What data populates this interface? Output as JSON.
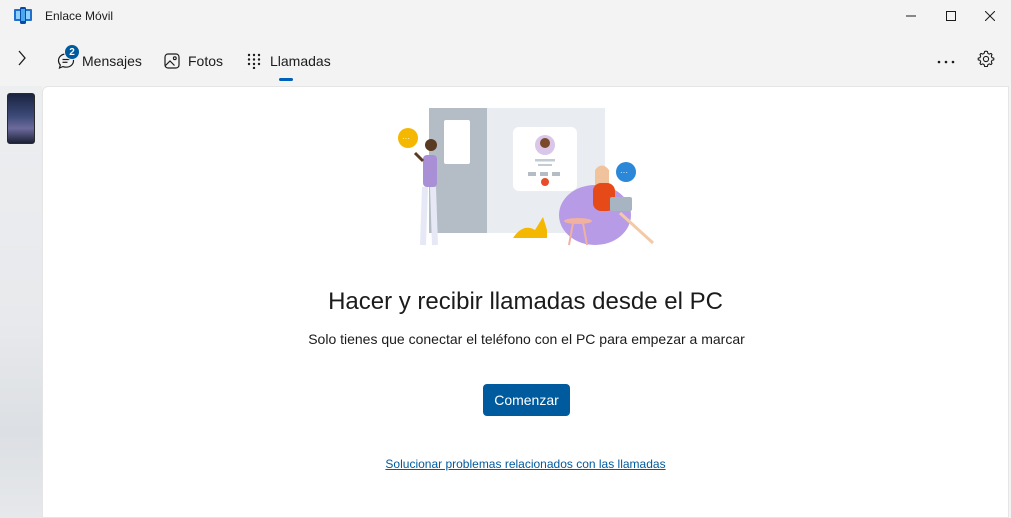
{
  "window": {
    "title": "Enlace Móvil",
    "icons": {
      "app": "phone-link-app-icon",
      "minimize": "minimize-icon",
      "maximize": "maximize-icon",
      "close": "close-icon"
    }
  },
  "nav": {
    "expand_icon": "chevron-right-icon",
    "tabs": [
      {
        "label": "Mensajes",
        "icon": "chat-icon",
        "badge": "2",
        "selected": false
      },
      {
        "label": "Fotos",
        "icon": "photo-icon",
        "selected": false
      },
      {
        "label": "Llamadas",
        "icon": "dialpad-icon",
        "selected": true
      }
    ],
    "more_icon": "more-icon",
    "settings_icon": "gear-icon"
  },
  "sidebar": {
    "device_icon": "phone-thumbnail"
  },
  "main": {
    "heading": "Hacer y recibir llamadas desde el PC",
    "subtext": "Solo tienes que conectar el teléfono con el PC para empezar a marcar",
    "start_button": "Comenzar",
    "troubleshoot_link": "Solucionar problemas relacionados con las llamadas"
  },
  "colors": {
    "accent": "#005a9e",
    "indicator": "#005fb8",
    "background": "#f3f3f3",
    "content_bg": "#ffffff"
  }
}
